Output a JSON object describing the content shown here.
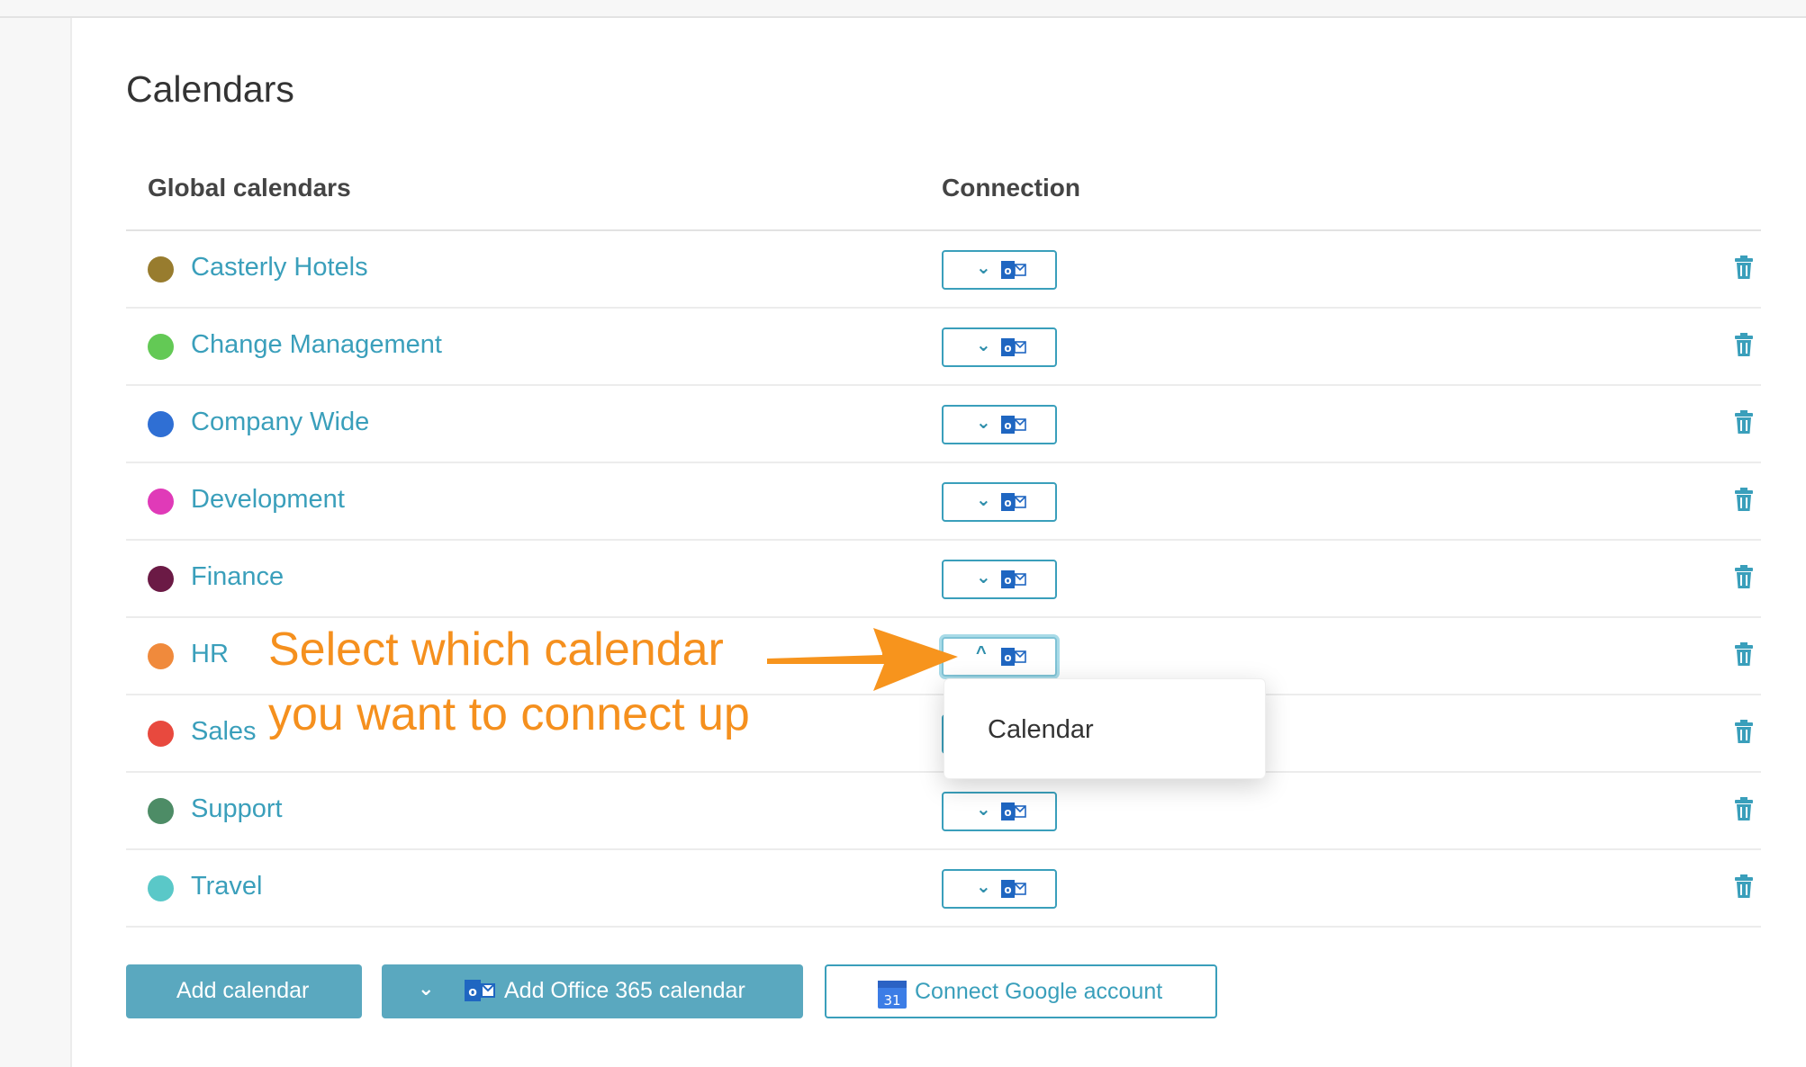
{
  "page": {
    "title": "Calendars"
  },
  "table": {
    "col_global": "Global calendars",
    "col_connection": "Connection"
  },
  "calendars": [
    {
      "name": "Casterly Hotels",
      "color": "#987c2e"
    },
    {
      "name": "Change Management",
      "color": "#63c955"
    },
    {
      "name": "Company Wide",
      "color": "#2f6fd4"
    },
    {
      "name": "Development",
      "color": "#e03ab8"
    },
    {
      "name": "Finance",
      "color": "#6b1a45"
    },
    {
      "name": "HR",
      "color": "#f08a3c"
    },
    {
      "name": "Sales",
      "color": "#e8493e"
    },
    {
      "name": "Support",
      "color": "#4d8c66"
    },
    {
      "name": "Travel",
      "color": "#5ac8c8"
    }
  ],
  "connection": {
    "icon": "outlook-icon",
    "chevron_closed": "⌄",
    "chevron_open": "^"
  },
  "dropdown": {
    "options": [
      "Calendar"
    ]
  },
  "annotation": {
    "line1": "Select which calendar",
    "line2": "you want to connect up",
    "color": "#f5901e"
  },
  "buttons": {
    "add_calendar": "Add calendar",
    "add_office365": "Add Office 365 calendar",
    "connect_google": "Connect Google account",
    "google_icon_text": "31"
  },
  "colors": {
    "accent": "#3a9fbb",
    "button_fill": "#5aa8bf"
  }
}
